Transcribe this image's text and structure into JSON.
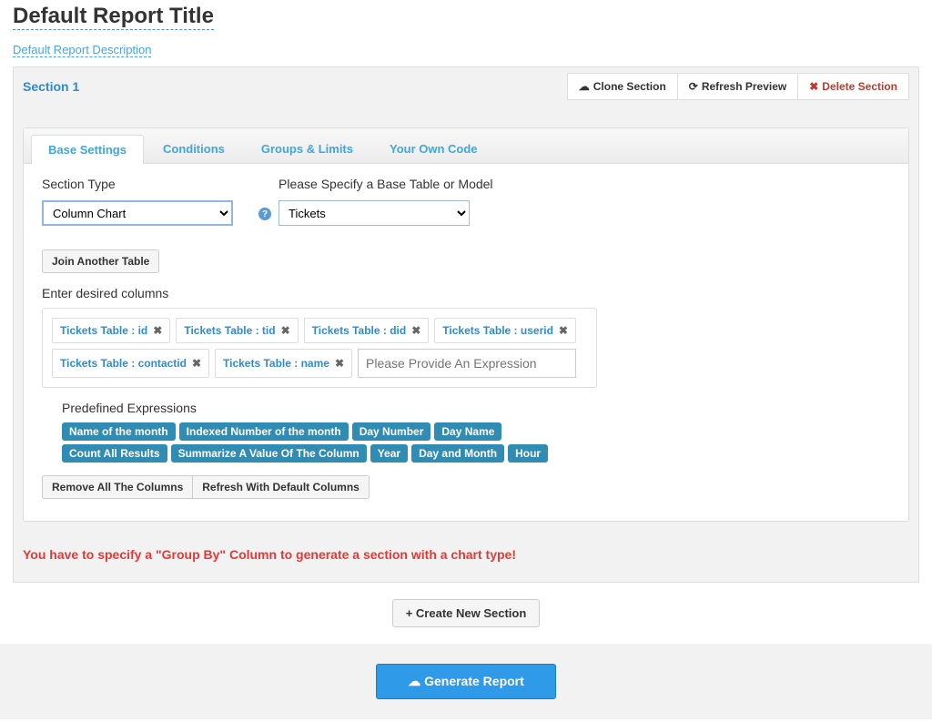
{
  "report": {
    "title": "Default Report Title",
    "description": "Default Report Description"
  },
  "section": {
    "name": "Section 1",
    "header_buttons": {
      "clone": "Clone Section",
      "refresh": "Refresh Preview",
      "delete": "Delete Section"
    }
  },
  "tabs": {
    "base": "Base Settings",
    "conditions": "Conditions",
    "groups": "Groups & Limits",
    "code": "Your Own Code"
  },
  "fields": {
    "section_type_label": "Section Type",
    "section_type_value": "Column Chart",
    "base_table_label": "Please Specify a Base Table or Model",
    "base_table_value": "Tickets",
    "join_another": "Join Another Table",
    "columns_label": "Enter desired columns",
    "expr_placeholder": "Please Provide An Expression"
  },
  "columns": [
    "Tickets Table : id",
    "Tickets Table : tid",
    "Tickets Table : did",
    "Tickets Table : userid",
    "Tickets Table : contactid",
    "Tickets Table : name"
  ],
  "predef": {
    "title": "Predefined Expressions",
    "items": [
      "Name of the month",
      "Indexed Number of the month",
      "Day Number",
      "Day Name",
      "Count All Results",
      "Summarize A Value Of The Column",
      "Year",
      "Day and Month",
      "Hour"
    ],
    "remove_all": "Remove All The Columns",
    "refresh_default": "Refresh With Default Columns"
  },
  "error": "You have to specify a \"Group By\" Column to generate a section with a chart type!",
  "create_new": "Create New Section",
  "generate": "Generate Report"
}
